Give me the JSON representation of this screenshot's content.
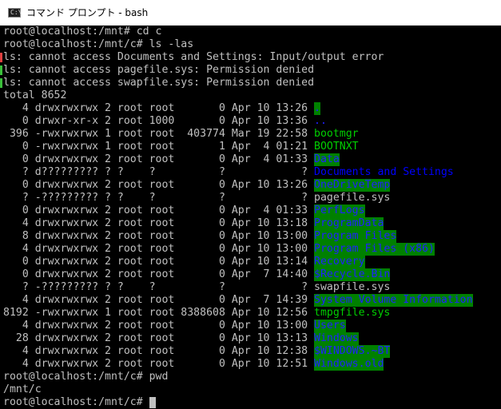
{
  "window": {
    "title": "コマンド プロンプト - bash",
    "icon": "cmd-icon",
    "icon_text": "C:\\"
  },
  "colors": {
    "background": "#000000",
    "text": "#c0c0c0",
    "dir_highlight_bg": "#008000",
    "dir_text": "#0000ff",
    "exec_text": "#00d000"
  },
  "terminal": {
    "lines": [
      {
        "type": "text",
        "text": "root@localhost:/mnt# cd c"
      },
      {
        "type": "text",
        "text": "root@localhost:/mnt/c# ls -las"
      },
      {
        "type": "error",
        "text": "ls: cannot access Documents and Settings: Input/output error",
        "mark": "red"
      },
      {
        "type": "error",
        "text": "ls: cannot access pagefile.sys: Permission denied",
        "mark": "green"
      },
      {
        "type": "error",
        "text": "ls: cannot access swapfile.sys: Permission denied",
        "mark": "green"
      },
      {
        "type": "text",
        "text": "total 8652"
      },
      {
        "type": "entry",
        "prefix": "   4 drwxrwxrwx 2 root root       0 Apr 10 13:26 ",
        "name": ".",
        "style": "c-hl-blue"
      },
      {
        "type": "entry",
        "prefix": "   0 drwxr-xr-x 2 root 1000       0 Apr 10 13:36 ",
        "name": "..",
        "style": "c-dir"
      },
      {
        "type": "entry",
        "prefix": " 396 -rwxrwxrwx 1 root root  403774 Mar 19 22:58 ",
        "name": "bootmgr",
        "style": "c-green"
      },
      {
        "type": "entry",
        "prefix": "   0 -rwxrwxrwx 1 root root       1 Apr  4 01:21 ",
        "name": "BOOTNXT",
        "style": "c-green"
      },
      {
        "type": "entry",
        "prefix": "   0 drwxrwxrwx 2 root root       0 Apr  4 01:33 ",
        "name": "Data",
        "style": "c-hl-blue"
      },
      {
        "type": "entry",
        "prefix": "   ? d????????? ? ?    ?          ?            ? ",
        "name": "Documents and Settings",
        "style": "c-blue"
      },
      {
        "type": "entry",
        "prefix": "   0 drwxrwxrwx 2 root root       0 Apr 10 13:26 ",
        "name": "OneDriveTemp",
        "style": "c-hl-blue"
      },
      {
        "type": "entry",
        "prefix": "   ? -????????? ? ?    ?          ?            ? ",
        "name": "pagefile.sys",
        "style": "c-plain"
      },
      {
        "type": "entry",
        "prefix": "   0 drwxrwxrwx 2 root root       0 Apr  4 01:33 ",
        "name": "PerfLogs",
        "style": "c-hl-blue"
      },
      {
        "type": "entry",
        "prefix": "   4 drwxrwxrwx 2 root root       0 Apr 10 13:18 ",
        "name": "ProgramData",
        "style": "c-hl-blue"
      },
      {
        "type": "entry",
        "prefix": "   8 drwxrwxrwx 2 root root       0 Apr 10 13:00 ",
        "name": "Program Files",
        "style": "c-hl-blue"
      },
      {
        "type": "entry",
        "prefix": "   4 drwxrwxrwx 2 root root       0 Apr 10 13:00 ",
        "name": "Program Files (x86)",
        "style": "c-hl-blue"
      },
      {
        "type": "entry",
        "prefix": "   0 drwxrwxrwx 2 root root       0 Apr 10 13:14 ",
        "name": "Recovery",
        "style": "c-hl-blue"
      },
      {
        "type": "entry",
        "prefix": "   0 drwxrwxrwx 2 root root       0 Apr  7 14:40 ",
        "name": "$Recycle.Bin",
        "style": "c-hl-blue"
      },
      {
        "type": "entry",
        "prefix": "   ? -????????? ? ?    ?          ?            ? ",
        "name": "swapfile.sys",
        "style": "c-plain"
      },
      {
        "type": "entry",
        "prefix": "   4 drwxrwxrwx 2 root root       0 Apr  7 14:39 ",
        "name": "System Volume Information",
        "style": "c-hl-blue"
      },
      {
        "type": "entry",
        "prefix": "8192 -rwxrwxrwx 1 root root 8388608 Apr 10 12:56 ",
        "name": "tmpgfile.sys",
        "style": "c-green"
      },
      {
        "type": "entry",
        "prefix": "   4 drwxrwxrwx 2 root root       0 Apr 10 13:00 ",
        "name": "Users",
        "style": "c-hl-blue"
      },
      {
        "type": "entry",
        "prefix": "  28 drwxrwxrwx 2 root root       0 Apr 10 13:13 ",
        "name": "Windows",
        "style": "c-hl-blue"
      },
      {
        "type": "entry",
        "prefix": "   4 drwxrwxrwx 2 root root       0 Apr 10 12:38 ",
        "name": "$WINDOWS.~BT",
        "style": "c-hl-blue"
      },
      {
        "type": "entry",
        "prefix": "   4 drwxrwxrwx 2 root root       0 Apr 10 12:51 ",
        "name": "Windows.old",
        "style": "c-hl-blue"
      },
      {
        "type": "text",
        "text": "root@localhost:/mnt/c# pwd"
      },
      {
        "type": "text",
        "text": "/mnt/c"
      },
      {
        "type": "prompt",
        "text": "root@localhost:/mnt/c# "
      }
    ]
  }
}
